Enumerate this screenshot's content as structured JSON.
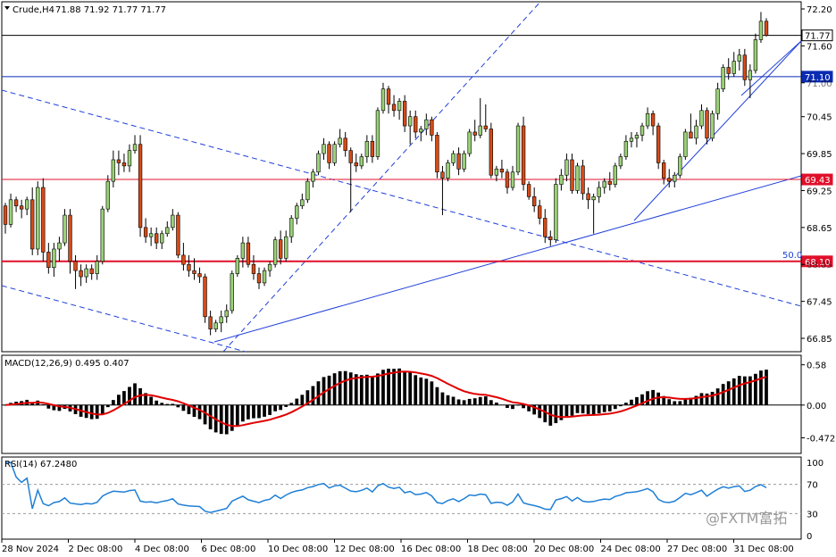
{
  "window": {
    "symbol_label": "Crude,H4",
    "ohlc_label": "71.88 71.92 71.77 71.77"
  },
  "chart_data": {
    "type": "candlestick",
    "symbol": "Crude",
    "timeframe": "H4",
    "price_axis": {
      "min": 66.85,
      "max": 72.2,
      "tick_labels": [
        "72.20",
        "71.60",
        "71.00",
        "70.45",
        "69.85",
        "69.25",
        "68.65",
        "68.05",
        "67.45",
        "66.85"
      ]
    },
    "time_labels": [
      "28 Nov 2024",
      "2 Dec 08:00",
      "4 Dec 08:00",
      "6 Dec 08:00",
      "10 Dec 08:00",
      "12 Dec 08:00",
      "16 Dec 08:00",
      "18 Dec 08:00",
      "20 Dec 08:00",
      "24 Dec 08:00",
      "27 Dec 08:00",
      "31 Dec 08:00"
    ],
    "horizontal_levels": [
      {
        "price": 71.77,
        "label": "71.77",
        "color": "#000000",
        "tag": "white"
      },
      {
        "price": 71.1,
        "label": "71.10",
        "color": "#0a2bb3",
        "tag": "blue"
      },
      {
        "price": 69.43,
        "label": "69.43",
        "color": "#e0102a",
        "tag": "red"
      },
      {
        "price": 68.1,
        "label": "68.10",
        "color": "#e0102a",
        "tag": "red"
      }
    ],
    "fib_label": "50.0",
    "candles": [
      [
        69.0,
        69.05,
        68.55,
        68.7
      ],
      [
        68.7,
        69.2,
        68.65,
        69.1
      ],
      [
        69.1,
        69.15,
        68.9,
        69.0
      ],
      [
        69.0,
        69.1,
        68.8,
        68.95
      ],
      [
        68.95,
        69.15,
        68.85,
        69.1
      ],
      [
        69.1,
        69.3,
        68.2,
        68.3
      ],
      [
        68.3,
        69.4,
        68.2,
        69.3
      ],
      [
        69.3,
        69.45,
        68.1,
        68.25
      ],
      [
        68.25,
        68.4,
        67.9,
        68.0
      ],
      [
        68.0,
        68.4,
        67.85,
        68.3
      ],
      [
        68.3,
        68.5,
        68.1,
        68.4
      ],
      [
        68.4,
        68.95,
        68.35,
        68.85
      ],
      [
        68.85,
        68.95,
        67.9,
        68.1
      ],
      [
        68.1,
        68.2,
        67.65,
        67.95
      ],
      [
        67.95,
        68.05,
        67.7,
        67.85
      ],
      [
        67.85,
        68.05,
        67.75,
        67.98
      ],
      [
        67.98,
        68.05,
        67.8,
        67.9
      ],
      [
        67.9,
        68.2,
        67.8,
        68.1
      ],
      [
        68.1,
        69.0,
        68.05,
        68.95
      ],
      [
        68.95,
        69.5,
        68.9,
        69.4
      ],
      [
        69.4,
        69.9,
        69.3,
        69.75
      ],
      [
        69.75,
        69.9,
        69.5,
        69.7
      ],
      [
        69.7,
        69.85,
        69.55,
        69.65
      ],
      [
        69.65,
        70.0,
        69.55,
        69.9
      ],
      [
        69.9,
        70.15,
        69.85,
        70.0
      ],
      [
        70.0,
        70.15,
        68.5,
        68.65
      ],
      [
        68.65,
        68.8,
        68.4,
        68.5
      ],
      [
        68.5,
        68.65,
        68.35,
        68.55
      ],
      [
        68.55,
        68.65,
        68.3,
        68.4
      ],
      [
        68.4,
        68.6,
        68.3,
        68.55
      ],
      [
        68.55,
        68.75,
        68.5,
        68.65
      ],
      [
        68.65,
        68.95,
        68.6,
        68.85
      ],
      [
        68.85,
        68.9,
        68.15,
        68.2
      ],
      [
        68.2,
        68.4,
        67.95,
        68.05
      ],
      [
        68.05,
        68.2,
        67.85,
        67.95
      ],
      [
        67.95,
        68.15,
        67.8,
        67.9
      ],
      [
        67.9,
        68.0,
        67.75,
        67.85
      ],
      [
        67.85,
        67.9,
        67.1,
        67.2
      ],
      [
        67.2,
        67.3,
        66.9,
        67.0
      ],
      [
        67.0,
        67.15,
        66.95,
        67.1
      ],
      [
        67.1,
        67.3,
        66.95,
        67.2
      ],
      [
        67.2,
        67.4,
        67.1,
        67.3
      ],
      [
        67.3,
        67.95,
        67.25,
        67.9
      ],
      [
        67.9,
        68.2,
        67.85,
        68.15
      ],
      [
        68.15,
        68.5,
        68.0,
        68.4
      ],
      [
        68.4,
        68.5,
        68.0,
        68.05
      ],
      [
        68.05,
        68.2,
        67.8,
        67.9
      ],
      [
        67.9,
        68.0,
        67.65,
        67.75
      ],
      [
        67.75,
        68.0,
        67.7,
        67.95
      ],
      [
        67.95,
        68.1,
        67.85,
        68.05
      ],
      [
        68.05,
        68.5,
        68.0,
        68.45
      ],
      [
        68.45,
        68.6,
        68.05,
        68.15
      ],
      [
        68.15,
        68.6,
        68.1,
        68.5
      ],
      [
        68.5,
        68.85,
        68.4,
        68.8
      ],
      [
        68.8,
        69.05,
        68.7,
        69.0
      ],
      [
        69.0,
        69.2,
        68.95,
        69.1
      ],
      [
        69.1,
        69.45,
        69.05,
        69.4
      ],
      [
        69.4,
        69.6,
        69.3,
        69.55
      ],
      [
        69.55,
        69.9,
        69.5,
        69.85
      ],
      [
        69.85,
        70.1,
        69.75,
        70.0
      ],
      [
        70.0,
        70.05,
        69.6,
        69.7
      ],
      [
        69.7,
        70.05,
        69.65,
        70.0
      ],
      [
        70.0,
        70.25,
        69.95,
        70.1
      ],
      [
        70.1,
        70.2,
        69.8,
        69.9
      ],
      [
        69.9,
        69.95,
        68.9,
        69.7
      ],
      [
        69.7,
        69.85,
        69.55,
        69.65
      ],
      [
        69.65,
        69.85,
        69.6,
        69.8
      ],
      [
        69.8,
        70.15,
        69.7,
        70.05
      ],
      [
        70.05,
        70.15,
        69.7,
        69.8
      ],
      [
        69.8,
        70.6,
        69.75,
        70.55
      ],
      [
        70.55,
        71.0,
        70.5,
        70.9
      ],
      [
        70.9,
        70.95,
        70.5,
        70.65
      ],
      [
        70.65,
        70.8,
        70.45,
        70.55
      ],
      [
        70.55,
        70.75,
        70.4,
        70.7
      ],
      [
        70.7,
        70.8,
        70.2,
        70.3
      ],
      [
        70.3,
        70.55,
        70.0,
        70.45
      ],
      [
        70.45,
        70.55,
        70.1,
        70.2
      ],
      [
        70.2,
        70.3,
        70.05,
        70.25
      ],
      [
        70.25,
        70.5,
        70.15,
        70.4
      ],
      [
        70.4,
        70.45,
        70.05,
        70.15
      ],
      [
        70.15,
        70.2,
        69.45,
        69.55
      ],
      [
        69.55,
        69.65,
        68.85,
        69.45
      ],
      [
        69.45,
        69.75,
        69.4,
        69.7
      ],
      [
        69.7,
        69.9,
        69.65,
        69.85
      ],
      [
        69.85,
        69.95,
        69.5,
        69.6
      ],
      [
        69.6,
        69.9,
        69.55,
        69.85
      ],
      [
        69.85,
        70.25,
        69.8,
        70.2
      ],
      [
        70.2,
        70.4,
        70.05,
        70.15
      ],
      [
        70.15,
        70.75,
        70.1,
        70.3
      ],
      [
        70.3,
        70.65,
        70.2,
        70.25
      ],
      [
        70.25,
        70.35,
        69.45,
        69.5
      ],
      [
        69.5,
        69.65,
        69.4,
        69.6
      ],
      [
        69.6,
        69.75,
        69.45,
        69.55
      ],
      [
        69.55,
        69.6,
        69.2,
        69.3
      ],
      [
        69.3,
        69.65,
        69.25,
        69.55
      ],
      [
        69.55,
        70.35,
        69.5,
        70.3
      ],
      [
        70.3,
        70.45,
        69.25,
        69.35
      ],
      [
        69.35,
        69.4,
        69.1,
        69.15
      ],
      [
        69.15,
        69.3,
        68.9,
        69.0
      ],
      [
        69.0,
        69.1,
        68.7,
        68.8
      ],
      [
        68.8,
        68.95,
        68.4,
        68.5
      ],
      [
        68.5,
        68.6,
        68.35,
        68.45
      ],
      [
        68.45,
        69.45,
        68.4,
        69.35
      ],
      [
        69.35,
        69.6,
        69.25,
        69.5
      ],
      [
        69.5,
        69.85,
        69.4,
        69.75
      ],
      [
        69.75,
        69.85,
        69.2,
        69.25
      ],
      [
        69.25,
        69.7,
        69.2,
        69.65
      ],
      [
        69.65,
        69.75,
        69.1,
        69.2
      ],
      [
        69.2,
        69.3,
        68.95,
        69.1
      ],
      [
        69.1,
        69.2,
        68.55,
        69.15
      ],
      [
        69.15,
        69.4,
        69.05,
        69.3
      ],
      [
        69.3,
        69.45,
        69.2,
        69.4
      ],
      [
        69.4,
        69.55,
        69.25,
        69.35
      ],
      [
        69.35,
        69.7,
        69.3,
        69.65
      ],
      [
        69.65,
        69.85,
        69.6,
        69.8
      ],
      [
        69.8,
        70.15,
        69.75,
        70.05
      ],
      [
        70.05,
        70.2,
        69.95,
        70.1
      ],
      [
        70.1,
        70.2,
        69.95,
        70.15
      ],
      [
        70.15,
        70.35,
        70.05,
        70.3
      ],
      [
        70.3,
        70.6,
        70.25,
        70.5
      ],
      [
        70.5,
        70.55,
        70.15,
        70.3
      ],
      [
        70.3,
        70.35,
        69.6,
        69.7
      ],
      [
        69.7,
        69.75,
        69.35,
        69.45
      ],
      [
        69.45,
        69.6,
        69.3,
        69.4
      ],
      [
        69.4,
        69.55,
        69.3,
        69.5
      ],
      [
        69.5,
        69.85,
        69.45,
        69.8
      ],
      [
        69.8,
        70.25,
        69.75,
        70.2
      ],
      [
        70.2,
        70.5,
        70.1,
        70.1
      ],
      [
        70.1,
        70.4,
        70.0,
        70.3
      ],
      [
        70.3,
        70.65,
        70.25,
        70.55
      ],
      [
        70.55,
        70.6,
        70.0,
        70.1
      ],
      [
        70.1,
        70.55,
        70.05,
        70.5
      ],
      [
        70.5,
        71.0,
        70.4,
        70.9
      ],
      [
        70.9,
        71.3,
        70.85,
        71.25
      ],
      [
        71.25,
        71.4,
        71.05,
        71.15
      ],
      [
        71.15,
        71.5,
        71.1,
        71.35
      ],
      [
        71.35,
        71.55,
        71.2,
        71.45
      ],
      [
        71.45,
        71.55,
        70.95,
        71.05
      ],
      [
        71.05,
        71.3,
        70.75,
        71.2
      ],
      [
        71.2,
        71.8,
        71.15,
        71.7
      ],
      [
        71.7,
        72.15,
        71.65,
        72.0
      ],
      [
        72.0,
        72.05,
        71.75,
        71.77
      ]
    ]
  },
  "macd": {
    "label": "MACD(12,26,9) 0.495 0.407",
    "axis_labels": [
      "0.58",
      "0.00",
      "-0.472"
    ],
    "range": [
      -0.62,
      0.64
    ]
  },
  "rsi": {
    "label": "RSI(14) 67.2480",
    "axis_labels": [
      "100",
      "70",
      "30",
      "0"
    ]
  },
  "watermark": "@FXTM富拓",
  "colors": {
    "bull": "#9bd178",
    "bear": "#d64b17",
    "wick": "#000000",
    "trend_blue": "#1f3fd9",
    "macd_signal": "#e00000",
    "rsi_line": "#1e7fd6"
  }
}
